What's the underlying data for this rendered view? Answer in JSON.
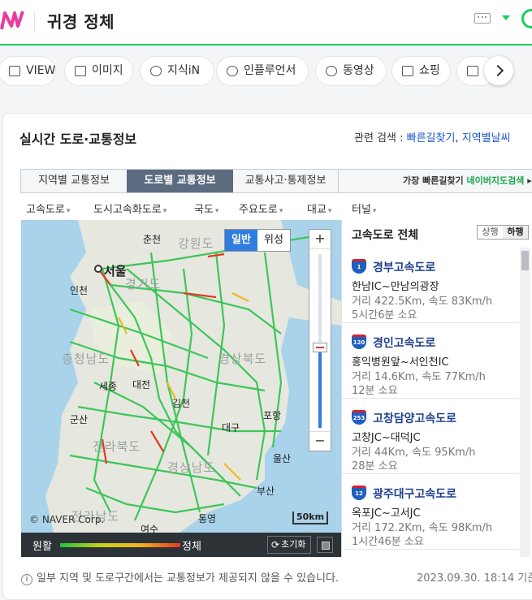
{
  "header": {
    "query": "귀경 정체",
    "brand_color": "#19ce60"
  },
  "tabs": [
    {
      "label": "VIEW",
      "icon": "document-icon"
    },
    {
      "label": "이미지",
      "icon": "image-icon"
    },
    {
      "label": "지식iN",
      "icon": "q-icon"
    },
    {
      "label": "인플루언서",
      "icon": "person-icon"
    },
    {
      "label": "동영상",
      "icon": "play-icon"
    },
    {
      "label": "쇼핑",
      "icon": "bag-icon"
    },
    {
      "label": "",
      "icon": "news-icon"
    }
  ],
  "panel": {
    "title": "실시간 도로·교통정보",
    "related_label": "관련 검색 : ",
    "related_links": [
      "빠른길찾기",
      "지역별날씨"
    ]
  },
  "subtabs": [
    "지역별 교통정보",
    "도로별 교통정보",
    "교통사고·통제정보"
  ],
  "fastest": {
    "text": "가장 빠른길찾기",
    "link": "네이버지도검색",
    "arrow": "▸"
  },
  "road_types": [
    "고속도로",
    "도시고속화도로",
    "국도",
    "주요도로",
    "대교",
    "터널"
  ],
  "map": {
    "map_type": [
      "일반",
      "위성"
    ],
    "zoom_in": "+",
    "zoom_out": "−",
    "copyright": "© NAVER Corp.",
    "scale": "50km",
    "labels": [
      "춘천",
      "강원도",
      "서울",
      "인천",
      "경기도",
      "충청남도",
      "경상북도",
      "세종",
      "대전",
      "김천",
      "군산",
      "대구",
      "포항",
      "전라북도",
      "울산",
      "경상남도",
      "부산",
      "통영",
      "전라남도",
      "여수"
    ]
  },
  "legend": {
    "smooth": "원활",
    "jam": "정체",
    "reset": "초기화"
  },
  "roadlist": {
    "title": "고속도로 전체",
    "directions": [
      "상행",
      "하행"
    ],
    "roads": [
      {
        "num": "1",
        "name": "경부고속도로",
        "section": "한남IC~만남의광장",
        "info": "거리 422.5Km, 속도 83Km/h",
        "time": "5시간6분 소요"
      },
      {
        "num": "120",
        "name": "경인고속도로",
        "section": "홍익병원앞~서인천IC",
        "info": "거리 14.6Km, 속도 77Km/h",
        "time": "12분 소요"
      },
      {
        "num": "253",
        "name": "고창담양고속도로",
        "section": "고창JC~대덕JC",
        "info": "거리 44Km, 속도 95Km/h",
        "time": "28분 소요"
      },
      {
        "num": "12",
        "name": "광주대구고속도로",
        "section": "옥포JC~고서JC",
        "info": "거리 172.2Km, 속도 98Km/h",
        "time": "1시간46분 소요"
      }
    ]
  },
  "footer": {
    "note": "일부 지역 및 도로구간에서는 교통정보가 제공되지 않을 수 있습니다.",
    "timestamp": "2023.09.30. 18:14 기준"
  }
}
